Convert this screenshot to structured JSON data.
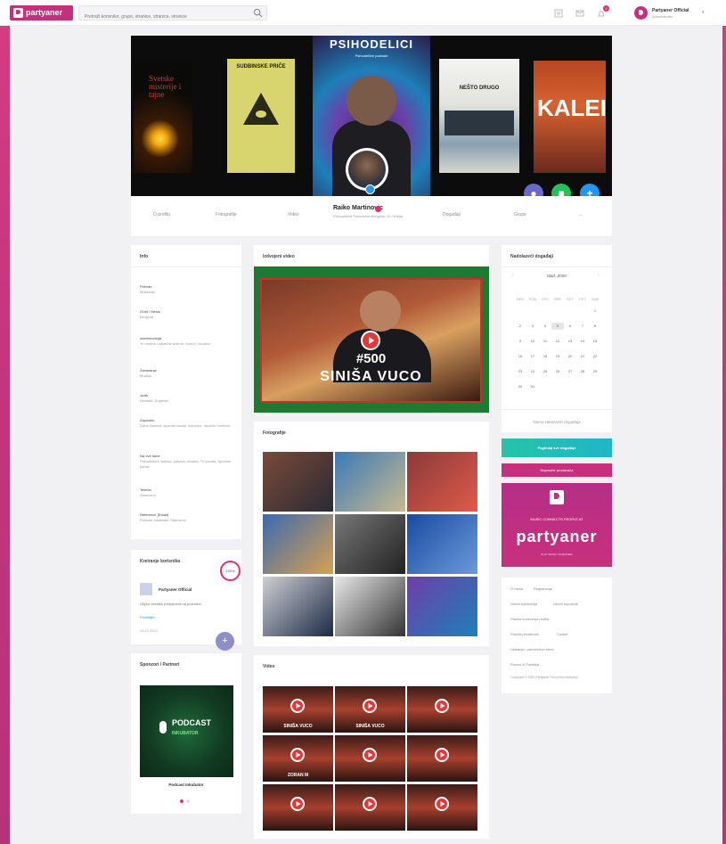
{
  "topbar": {
    "logo": "partyaner",
    "search_placeholder": "Pretraži korisnike, grupe, stranice, stranice, stranice",
    "notif_count": "2",
    "user_name": "Partyaner Official",
    "user_sub": "Administrator"
  },
  "cover": {
    "book1": "Svetske misterije i tajne",
    "book2": "SUDBINSKE PRIČE",
    "book3": "PSIHODELICI",
    "book3_sub": "Psihodelični  podcast",
    "book4": "NEŠTO DRUGO",
    "book5": "KALEIDOSKOP"
  },
  "profile": {
    "name": "Raiko Martinovic",
    "location": "Psihodelični Psihodelici Beograd, 25 / Srbija"
  },
  "profile_nav": [
    "O profilu",
    "Fotografije",
    "Video",
    "Događaji",
    "Grupe",
    "..."
  ],
  "info": {
    "title": "Info",
    "fields": [
      {
        "label": "Prihvao",
        "value": "Muškarac"
      },
      {
        "label": "Grad / Mesto",
        "value": "Beograd"
      },
      {
        "label": "Interesovanja",
        "value": "Tri modne i zabavne kulture, humor i muzika"
      },
      {
        "label": "Zanimanje",
        "value": "Muzika"
      },
      {
        "label": "Jezik",
        "value": "Hrvatski, Engleski"
      },
      {
        "label": "Zaposlen",
        "value": "Dana članova, sportski kanali, kolumna, muzički i kulturni"
      },
      {
        "label": "Na ove dane",
        "value": "Psihodelični, kultura, zabava, muzika, Tri kanala, Sportski kanali"
      },
      {
        "label": "Telefon",
        "value": "Sakriveno"
      },
      {
        "label": "Reference (Email)",
        "value": "Podcast Inkubator, Sakriveno"
      }
    ]
  },
  "creation": {
    "title": "Kreiranje korisnika",
    "percent": "100%",
    "owner": "Partyaner Official",
    "text": "Objavi čestitke partyanera na prazniku!",
    "link": "Pročitajte",
    "date": "16.11.2020"
  },
  "sponsors": {
    "title": "Sponzori / Partneri",
    "podcast": "PODCAST",
    "podcast_sub": "INKUBATOR",
    "caption": "Podcast Inkubator"
  },
  "featured_video": {
    "title": "Izdvojeni video",
    "line1": "#500",
    "line2": "SINIŠA VUCO"
  },
  "photos": {
    "title": "Fotografije"
  },
  "videos": {
    "title": "Video",
    "captions": [
      "SINIŠA VUCO",
      "SINIŠA VUCO",
      "",
      "ZORAN M",
      "",
      "",
      "",
      "",
      ""
    ]
  },
  "calendar": {
    "title": "Nadolazeći događaji",
    "month": "Mart, 2020",
    "dow": [
      "NED",
      "PON",
      "UTO",
      "SRE",
      "ČET",
      "PET",
      "SUB"
    ],
    "days": [
      "",
      "",
      "",
      "",
      "",
      "",
      "1",
      "2",
      "3",
      "4",
      "5",
      "6",
      "7",
      "8",
      "9",
      "10",
      "11",
      "12",
      "13",
      "14",
      "15",
      "16",
      "17",
      "18",
      "19",
      "20",
      "21",
      "22",
      "23",
      "24",
      "25",
      "26",
      "27",
      "28",
      "29",
      "30",
      "31"
    ],
    "today": "5",
    "no_events": "Nema zakazanih događaja",
    "button": "Pogledaj sve događaje",
    "button2": "Napravite prodavača"
  },
  "promo": {
    "tagline": "MUSIC CONNECTS PEOPLE AT",
    "brand": "partyaner",
    "fine": "PLAY MUSIC TOGETHER"
  },
  "footer_links": [
    "O nama",
    "Registracija",
    "Uslovi korišćenja",
    "Uslovi kupovine",
    "Pravila korišćenja profila",
    "Pravila privatnosti",
    "Cookie",
    "Ukidanje i partnerstvo firme",
    "Pomoć & Podrška"
  ],
  "copyright": "Copyright © 2020 Partyaner Sva prava zadržana",
  "colors": {
    "brand": "#c4307c",
    "accent_teal": "#26c3a8",
    "play_red": "#e1393a"
  }
}
